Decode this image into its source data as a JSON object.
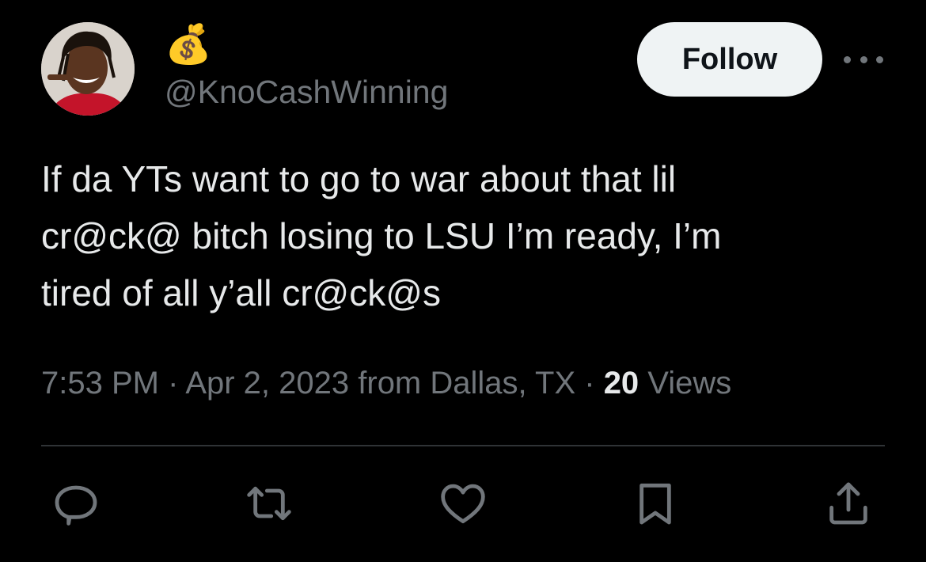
{
  "author": {
    "display_name": "💰",
    "handle": "@KnoCashWinning"
  },
  "header": {
    "follow_label": "Follow"
  },
  "tweet": {
    "lines": [
      "If da YTs want to go to war about that lil",
      "cr@ck@ bitch losing to LSU I’m ready, I’m",
      "tired of all y’all cr@ck@s"
    ]
  },
  "meta": {
    "time": "7:53 PM",
    "sep1": " · ",
    "date": "Apr 2, 2023",
    "location": " from Dallas, TX",
    "sep2": " · ",
    "views_count": "20",
    "views_label": " Views"
  },
  "actions": [
    "reply-icon",
    "retweet-icon",
    "like-icon",
    "bookmark-icon",
    "share-icon"
  ],
  "colors": {
    "background": "#000000",
    "text": "#e7e9ea",
    "secondary": "#71767b",
    "follow_bg": "#eff3f4",
    "divider": "#2f3336"
  }
}
